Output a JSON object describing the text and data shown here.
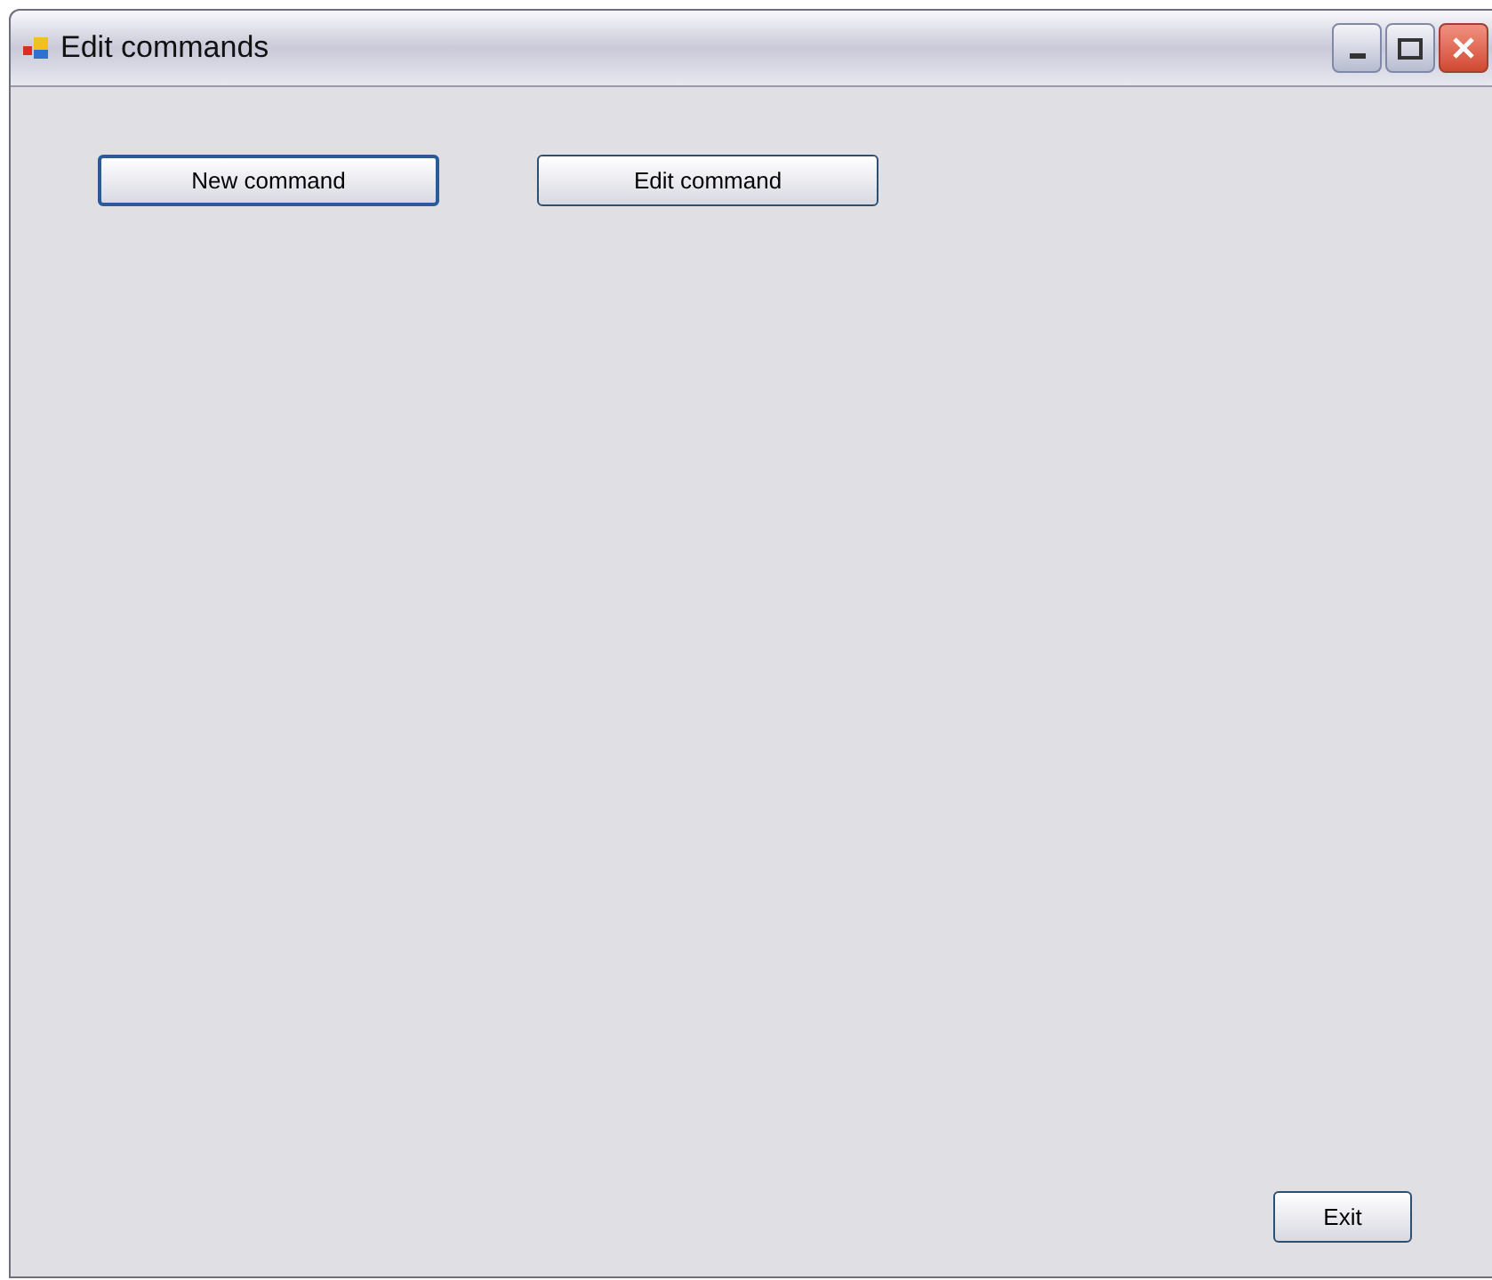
{
  "window": {
    "title": "Edit commands"
  },
  "buttons": [
    {
      "label": "New command",
      "focused": true
    },
    {
      "label": "Edit command",
      "focused": false
    }
  ],
  "exit_button": {
    "label": "Exit",
    "focused": false
  }
}
